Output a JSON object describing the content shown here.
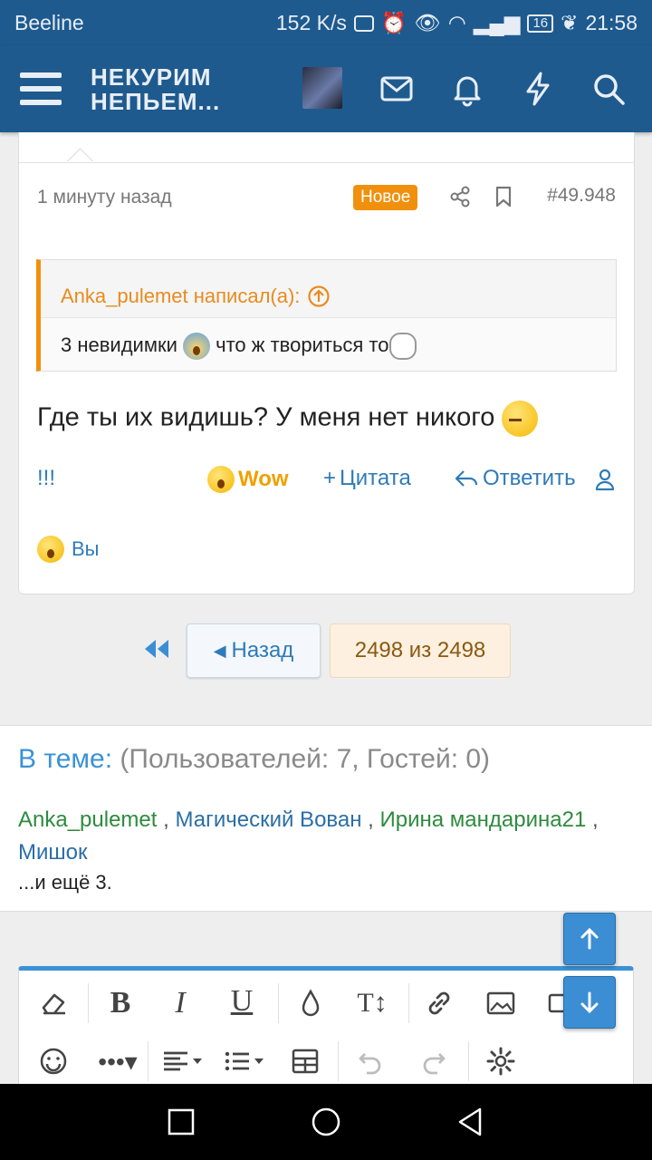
{
  "status_bar": {
    "carrier": "Beeline",
    "net_speed": "152 K/s",
    "battery": "16",
    "time": "21:58"
  },
  "header": {
    "logo_line1": "НЕКУРИМ",
    "logo_line2": "НЕПЬЕМ..."
  },
  "post": {
    "time": "1 минуту назад",
    "badge": "Новое",
    "number": "#49.948",
    "quote_author": "Anka_pulemet написал(а):",
    "quote_text_1": "3 невидимки",
    "quote_text_2": "что ж твориться то",
    "body": "Где ты их видишь? У меня нет никого",
    "actions": {
      "report": "!!!",
      "wow": "Wow",
      "quote": "Цитата",
      "reply": "Ответить"
    },
    "reactions_by": "Вы"
  },
  "pagination": {
    "back": "Назад",
    "current": "2498 из 2498"
  },
  "online": {
    "title_label": "В теме:",
    "title_counts": "(Пользователей: 7, Гостей: 0)",
    "users": [
      "Anka_pulemet",
      "Магический Вован",
      "Ирина мандарина21",
      "Мишок"
    ],
    "more": "...и ещё 3."
  },
  "icons": [
    "menu-icon",
    "mail-icon",
    "bell-icon",
    "bolt-icon",
    "search-icon",
    "share-icon",
    "bookmark-icon",
    "user-icon",
    "arrow-up-icon",
    "arrow-down-icon"
  ],
  "colors": {
    "header_bg": "#1e5a8e",
    "accent_orange": "#f0900d",
    "link_blue": "#2f7bb8",
    "user_green": "#2e8b3e"
  }
}
